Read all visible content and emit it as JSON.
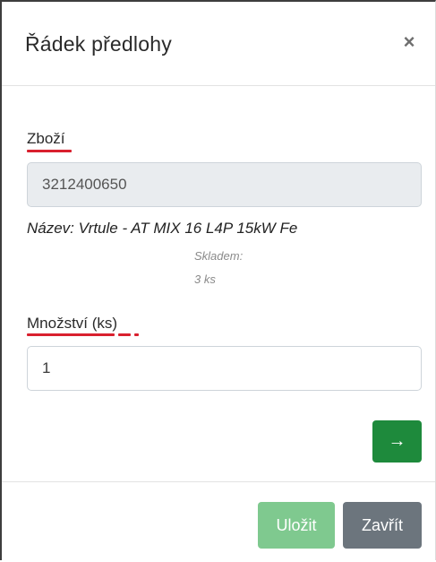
{
  "modal": {
    "title": "Řádek předlohy",
    "close_symbol": "×",
    "close_icon": "close-icon"
  },
  "form": {
    "item_label": "Zboží",
    "item_value": "3212400650",
    "product_name": "Název: Vrtule - AT MIX 16 L4P 15kW Fe",
    "stock_label": "Skladem:",
    "stock_value": "3 ks",
    "quantity_label": "Množství (ks)",
    "quantity_value": "1",
    "go_symbol": "→",
    "go_icon": "arrow-right-icon"
  },
  "footer": {
    "save_label": "Uložit",
    "close_label": "Zavřít"
  },
  "colors": {
    "accent_green": "#1e8a3c",
    "save_disabled": "#7fc98f",
    "secondary": "#6c757d",
    "spellcheck": "#d9202e"
  }
}
